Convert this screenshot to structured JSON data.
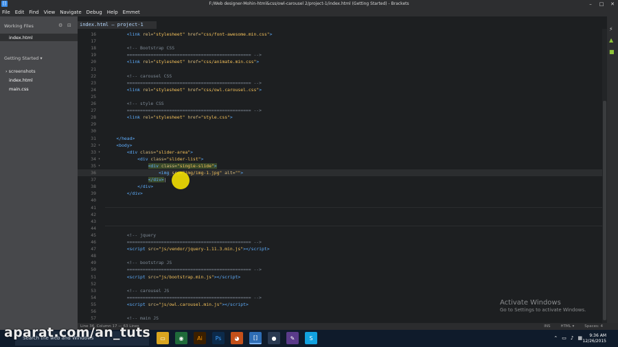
{
  "window": {
    "title": "F:/Web designer-Mohin-html&css/owl-carousel 2/project-1/index.html (Getting Started) - Brackets"
  },
  "menu": [
    "File",
    "Edit",
    "Find",
    "View",
    "Navigate",
    "Debug",
    "Help",
    "Emmet"
  ],
  "sidebar": {
    "working_files_label": "Working Files",
    "working_files": [
      "index.html"
    ],
    "project_label": "Getting Started ▾",
    "tree": [
      {
        "label": "› screenshots",
        "indent": 0
      },
      {
        "label": "index.html",
        "indent": 1
      },
      {
        "label": "main.css",
        "indent": 1
      }
    ]
  },
  "tab": {
    "label": "index.html — project-1"
  },
  "code_lines": [
    {
      "n": "16",
      "html": "        <span class='tag'>&lt;link</span> <span class='attr'>rel=</span><span class='str'>\"stylesheet\"</span> <span class='attr'>href=</span><span class='str'>\"css/font-awesome.min.css\"</span><span class='tag'>&gt;</span>"
    },
    {
      "n": "17",
      "html": ""
    },
    {
      "n": "18",
      "html": "        <span class='cmt'>&lt;!-- Bootstrap CSS</span>"
    },
    {
      "n": "19",
      "html": "        <span class='cmt'>=============================================== --&gt;</span>"
    },
    {
      "n": "20",
      "html": "        <span class='tag'>&lt;link</span> <span class='attr'>rel=</span><span class='str'>\"stylesheet\"</span> <span class='attr'>href=</span><span class='str'>\"css/animate.min.css\"</span><span class='tag'>&gt;</span>"
    },
    {
      "n": "21",
      "html": ""
    },
    {
      "n": "22",
      "html": "        <span class='cmt'>&lt;!-- carousel CSS</span>"
    },
    {
      "n": "23",
      "html": "        <span class='cmt'>=============================================== --&gt;</span>"
    },
    {
      "n": "24",
      "html": "        <span class='tag'>&lt;link</span> <span class='attr'>rel=</span><span class='str'>\"stylesheet\"</span> <span class='attr'>href=</span><span class='str'>\"css/owl.carousel.css\"</span><span class='tag'>&gt;</span>"
    },
    {
      "n": "25",
      "html": ""
    },
    {
      "n": "26",
      "html": "        <span class='cmt'>&lt;!-- style CSS</span>"
    },
    {
      "n": "27",
      "html": "        <span class='cmt'>=============================================== --&gt;</span>"
    },
    {
      "n": "28",
      "html": "        <span class='tag'>&lt;link</span> <span class='attr'>rel=</span><span class='str'>\"stylesheet\"</span> <span class='attr'>href=</span><span class='str'>\"style.css\"</span><span class='tag'>&gt;</span>"
    },
    {
      "n": "29",
      "html": ""
    },
    {
      "n": "30",
      "html": ""
    },
    {
      "n": "31",
      "html": "    <span class='tag'>&lt;/head&gt;</span>"
    },
    {
      "n": "32",
      "html": "    <span class='tag'>&lt;body&gt;</span>",
      "fold": "▾"
    },
    {
      "n": "33",
      "html": "        <span class='tag'>&lt;div</span> <span class='attr'>class=</span><span class='str'>\"slider-area\"</span><span class='tag'>&gt;</span>",
      "fold": "▾"
    },
    {
      "n": "34",
      "html": "            <span class='tag'>&lt;div</span> <span class='attr'>class=</span><span class='str'>\"slider-list\"</span><span class='tag'>&gt;</span>",
      "fold": "▾"
    },
    {
      "n": "35",
      "html": "                <span class='hl'><span class='tag'>&lt;div</span> <span class='attr'>class=</span><span class='str'>\"single-slide\"</span><span class='tag'>&gt;</span></span>",
      "fold": "▾"
    },
    {
      "n": "36",
      "html": "                    <span class='tag'>&lt;img</span> <span class='attr'>src=</span><span class='str'>\"img/img-1.jpg\"</span> <span class='attr'>alt=</span><span class='str'>\"\"</span><span class='tag'>&gt;</span>"
    },
    {
      "n": "37",
      "html": "                <span class='hl'><span class='tag'>&lt;/div&gt;</span></span>|"
    },
    {
      "n": "38",
      "html": "            <span class='tag'>&lt;/div&gt;</span>"
    },
    {
      "n": "39",
      "html": "        <span class='tag'>&lt;/div&gt;</span>"
    },
    {
      "n": "40",
      "html": ""
    },
    {
      "n": "41",
      "html": ""
    },
    {
      "n": "42",
      "html": ""
    },
    {
      "n": "43",
      "html": ""
    },
    {
      "n": "44",
      "html": ""
    },
    {
      "n": "45",
      "html": "        <span class='cmt'>&lt;!-- jquery</span>"
    },
    {
      "n": "46",
      "html": "        <span class='cmt'>=============================================== --&gt;</span>"
    },
    {
      "n": "47",
      "html": "        <span class='tag'>&lt;script</span> <span class='attr'>src=</span><span class='str'>\"js/vendor/jquery-1.11.3.min.js\"</span><span class='tag'>&gt;&lt;/script&gt;</span>"
    },
    {
      "n": "48",
      "html": ""
    },
    {
      "n": "49",
      "html": "        <span class='cmt'>&lt;!-- bootstrap JS</span>"
    },
    {
      "n": "50",
      "html": "        <span class='cmt'>=============================================== --&gt;</span>"
    },
    {
      "n": "51",
      "html": "        <span class='tag'>&lt;script</span> <span class='attr'>src=</span><span class='str'>\"js/bootstrap.min.js\"</span><span class='tag'>&gt;&lt;/script&gt;</span>"
    },
    {
      "n": "52",
      "html": ""
    },
    {
      "n": "53",
      "html": "        <span class='cmt'>&lt;!-- carousel JS</span>"
    },
    {
      "n": "54",
      "html": "        <span class='cmt'>=============================================== --&gt;</span>"
    },
    {
      "n": "55",
      "html": "        <span class='tag'>&lt;script</span> <span class='attr'>src=</span><span class='str'>\"js/owl.carousel.min.js\"</span><span class='tag'>&gt;&lt;/script&gt;</span>"
    },
    {
      "n": "56",
      "html": ""
    },
    {
      "n": "57",
      "html": "        <span class='cmt'>&lt;!-- main JS</span>"
    }
  ],
  "statusbar": {
    "position": "Line 36, Column 17 — 63 Lines",
    "ins": "INS",
    "mode": "HTML ▾",
    "spaces": "Spaces: 4"
  },
  "activate": {
    "title": "Activate Windows",
    "subtitle": "Go to Settings to activate Windows."
  },
  "taskbar": {
    "search_placeholder": "Search the web and Windows",
    "time": "9:36 AM",
    "date": "12/26/2015"
  },
  "watermark": "aparat.com/an_tuts"
}
